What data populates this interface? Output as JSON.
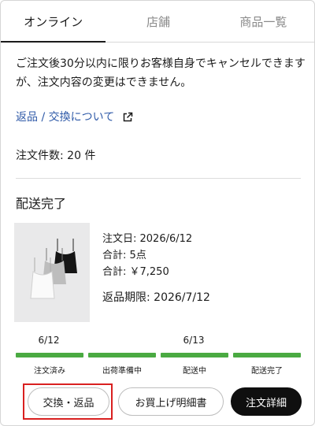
{
  "tabs": [
    {
      "label": "オンライン",
      "active": true
    },
    {
      "label": "店舗",
      "active": false
    },
    {
      "label": "商品一覧",
      "active": false
    }
  ],
  "notice": "ご注文後30分以内に限りお客様自身でキャンセルできますが、注文内容の変更はできません。",
  "returns_link": {
    "label": "返品 / 交換について",
    "icon": "external-link-icon"
  },
  "order_count": "注文件数: 20 件",
  "order": {
    "status": "配送完了",
    "image": "camisole-product-image",
    "order_date": "注文日: 2026/6/12",
    "items": "合計: 5点",
    "total": "合計: ￥7,250",
    "return_deadline": "返品期限: 2026/7/12"
  },
  "progress": {
    "dates": [
      "6/12",
      "6/13"
    ],
    "steps": [
      "注文済み",
      "出荷準備中",
      "配送中",
      "配送完了"
    ],
    "completed_steps": 4,
    "color": "#4aaa42"
  },
  "buttons": {
    "exchange": "交換・返品",
    "receipt": "お買上げ明細書",
    "detail": "注文詳細"
  },
  "colors": {
    "link": "#2f5aa8",
    "highlight": "#d92020",
    "primary_button": "#0f0f0f"
  }
}
